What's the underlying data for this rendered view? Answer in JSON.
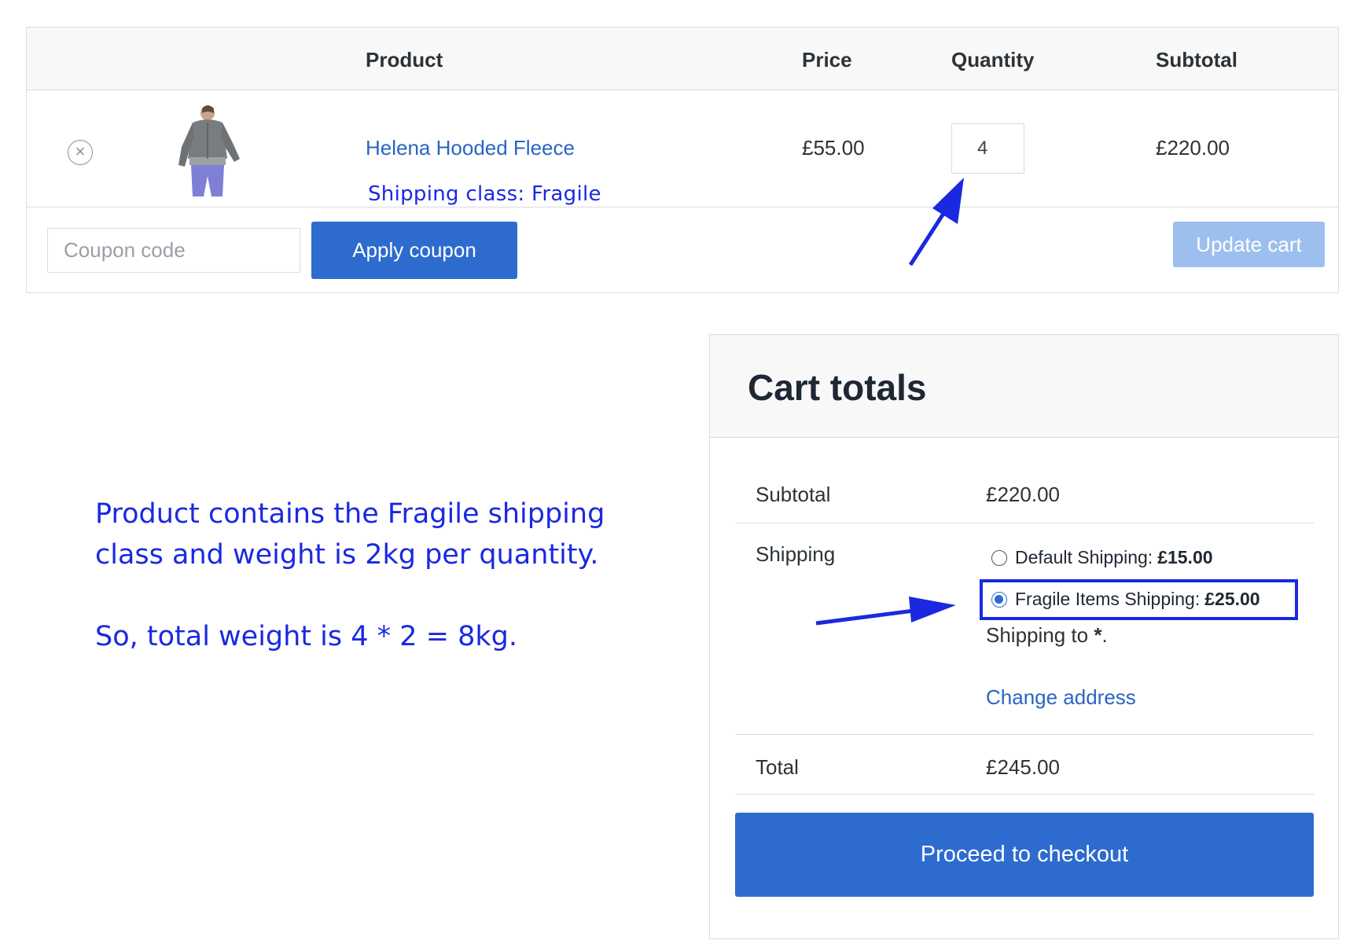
{
  "cart": {
    "headers": {
      "product": "Product",
      "price": "Price",
      "quantity": "Quantity",
      "subtotal": "Subtotal"
    },
    "item": {
      "remove_icon": "close-circle-icon",
      "name": "Helena Hooded Fleece",
      "shipping_class_note": "Shipping class: Fragile",
      "price": "£55.00",
      "quantity": "4",
      "subtotal": "£220.00"
    },
    "coupon_placeholder": "Coupon code",
    "apply_coupon_label": "Apply coupon",
    "update_cart_label": "Update cart"
  },
  "annotation": {
    "line1": "Product contains the Fragile shipping class and weight is 2kg per quantity.",
    "line2": "So, total weight is 4 * 2 = 8kg."
  },
  "totals": {
    "title": "Cart totals",
    "subtotal_label": "Subtotal",
    "subtotal_value": "£220.00",
    "shipping_label": "Shipping",
    "options": [
      {
        "label": "Default Shipping:",
        "price": "£15.00",
        "selected": false
      },
      {
        "label": "Fragile Items Shipping:",
        "price": "£25.00",
        "selected": true
      }
    ],
    "shipping_to_prefix": "Shipping to",
    "shipping_to_value": "*",
    "shipping_to_suffix": ".",
    "change_address_label": "Change address",
    "total_label": "Total",
    "total_value": "£245.00",
    "checkout_label": "Proceed to checkout"
  },
  "colors": {
    "accent": "#2d6bcf",
    "link": "#2a64c5",
    "annotation": "#1a29e0",
    "disabled_button": "#9dbfee"
  }
}
